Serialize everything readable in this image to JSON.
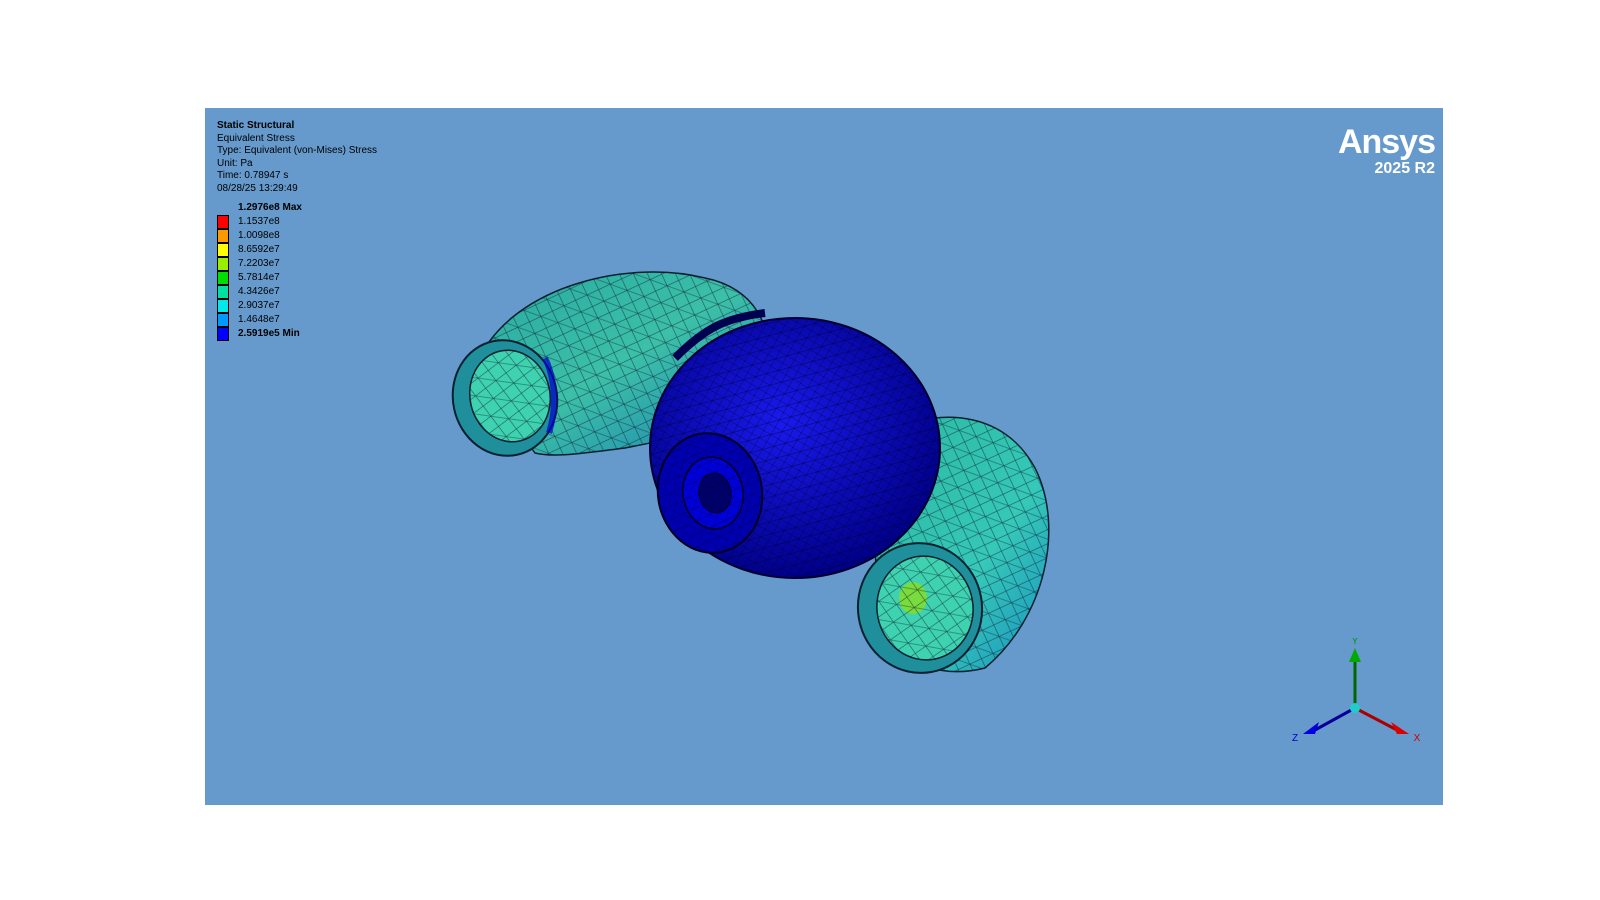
{
  "info": {
    "analysis": "Static Structural",
    "result": "Equivalent Stress",
    "type": "Type: Equivalent (von-Mises) Stress",
    "unit": "Unit: Pa",
    "time": "Time: 0.78947 s",
    "datetime": "08/28/25 13:29:49"
  },
  "legend": {
    "entries": [
      {
        "label": "1.2976e8 Max",
        "color": "#ff0000",
        "bold": true
      },
      {
        "label": "1.1537e8",
        "color": "#ff0000"
      },
      {
        "label": "1.0098e8",
        "color": "#ff9900"
      },
      {
        "label": "8.6592e7",
        "color": "#ffff00"
      },
      {
        "label": "7.2203e7",
        "color": "#99ee00"
      },
      {
        "label": "5.7814e7",
        "color": "#00dd00"
      },
      {
        "label": "4.3426e7",
        "color": "#00e0a0"
      },
      {
        "label": "2.9037e7",
        "color": "#00e8e8"
      },
      {
        "label": "1.4648e7",
        "color": "#0099ff"
      },
      {
        "label": "2.5919e5 Min",
        "color": "#0000ff",
        "bold": true
      }
    ]
  },
  "brand": {
    "name": "Ansys",
    "version": "2025 R2"
  },
  "triad": {
    "x": "X",
    "y": "Y",
    "z": "Z"
  },
  "colors": {
    "background": "#6699cc",
    "low_stress": "#0000cc",
    "mid_stress": "#1fb8a8"
  }
}
